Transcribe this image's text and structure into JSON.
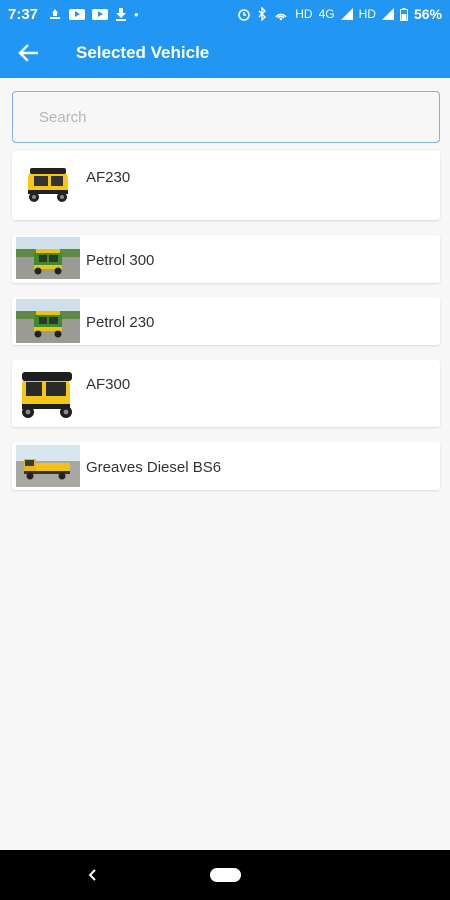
{
  "status_bar": {
    "time": "7:37",
    "network": "HD",
    "mobile": "4G",
    "network2": "HD",
    "battery": "56%"
  },
  "app_bar": {
    "title": "Selected Vehicle",
    "back_icon": "arrow-left-icon"
  },
  "search": {
    "placeholder": "Search",
    "value": ""
  },
  "vehicles": [
    {
      "name": "AF230",
      "image": "yellow-rickshaw-photo"
    },
    {
      "name": "Petrol 300",
      "image": "green-rickshaw-road-photo"
    },
    {
      "name": "Petrol 230",
      "image": "green-rickshaw-road-photo"
    },
    {
      "name": "AF300",
      "image": "yellow-rickshaw-photo"
    },
    {
      "name": "Greaves Diesel BS6",
      "image": "yellow-cargo-rickshaw-photo"
    }
  ],
  "colors": {
    "primary": "#2196f3",
    "background": "#f7f7f8",
    "card": "#ffffff",
    "rickshaw_yellow": "#f5c518",
    "rickshaw_green": "#3f8a2e"
  }
}
